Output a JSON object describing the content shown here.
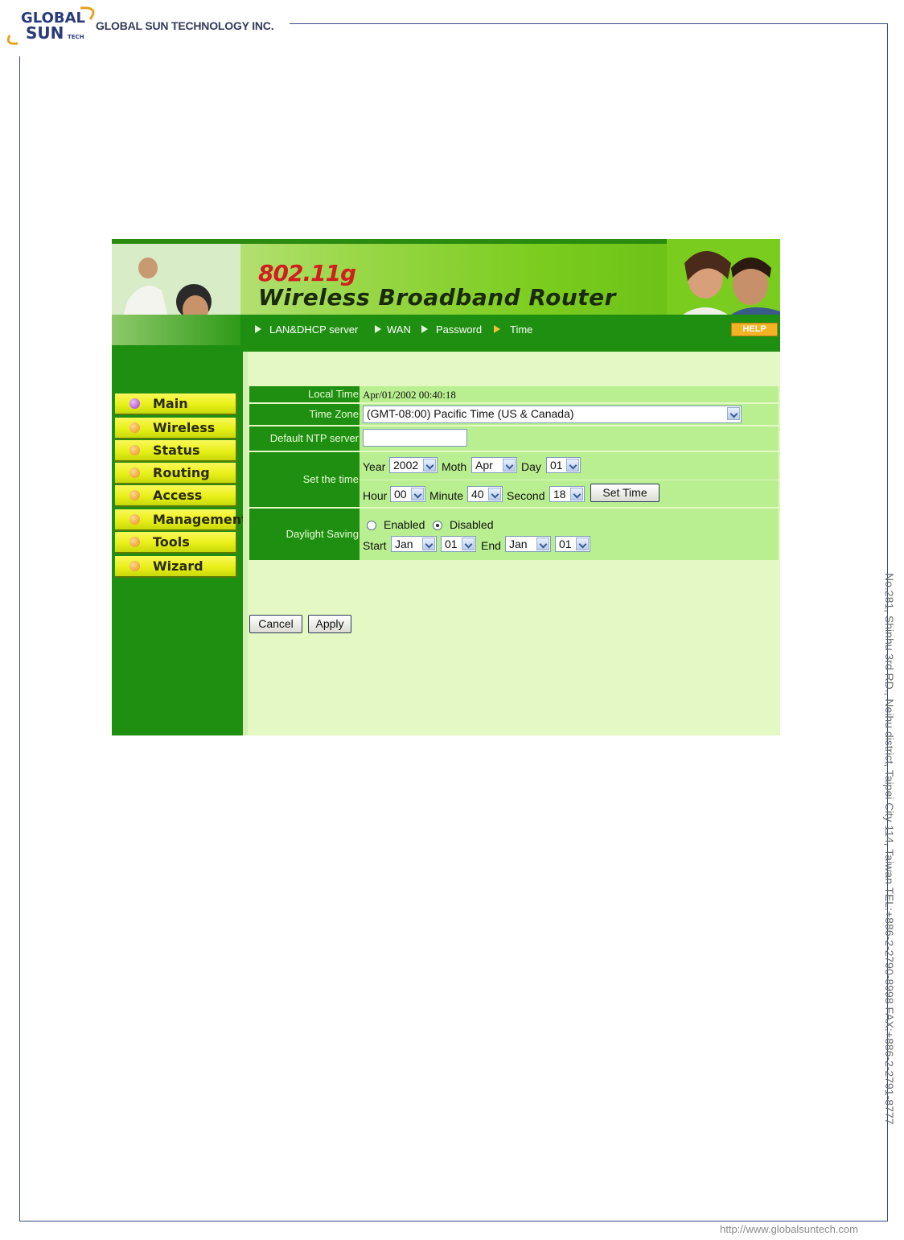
{
  "document": {
    "company_name": "GLOBAL SUN TECHNOLOGY INC.",
    "logo_text": "GLOBAL SUN TECH",
    "side_address": "No.281, Shinhu 3rd RD., Neihu district, Taipei City 114, Taiwan   TEL:+886-2-2790-8998   FAX:+886-2-2791-8777",
    "footer_url": "http://www.globalsuntech.com"
  },
  "header": {
    "model": "802.11g",
    "title": "Wireless Broadband Router",
    "nav": [
      {
        "label": "LAN&DHCP server"
      },
      {
        "label": "WAN"
      },
      {
        "label": "Password"
      },
      {
        "label": "Time",
        "active": true
      }
    ],
    "help_label": "HELP"
  },
  "sidebar": {
    "items": [
      {
        "label": "Main",
        "active": true
      },
      {
        "label": "Wireless"
      },
      {
        "label": "Status"
      },
      {
        "label": "Routing"
      },
      {
        "label": "Access"
      },
      {
        "label": "Management"
      },
      {
        "label": "Tools"
      },
      {
        "label": "Wizard"
      }
    ]
  },
  "form": {
    "local_time": {
      "label": "Local Time",
      "value": "Apr/01/2002 00:40:18"
    },
    "time_zone": {
      "label": "Time Zone",
      "value": "(GMT-08:00) Pacific Time (US & Canada)"
    },
    "ntp": {
      "label": "Default NTP server",
      "value": ""
    },
    "set_time": {
      "label": "Set the time",
      "year_label": "Year",
      "year": "2002",
      "month_label": "Moth",
      "month": "Apr",
      "day_label": "Day",
      "day": "01",
      "hour_label": "Hour",
      "hour": "00",
      "minute_label": "Minute",
      "minute": "40",
      "second_label": "Second",
      "second": "18",
      "button": "Set Time"
    },
    "daylight": {
      "label": "Daylight Saving",
      "enabled_label": "Enabled",
      "disabled_label": "Disabled",
      "selected": "Disabled",
      "start_label": "Start",
      "start_month": "Jan",
      "start_day": "01",
      "end_label": "End",
      "end_month": "Jan",
      "end_day": "01"
    },
    "cancel_label": "Cancel",
    "apply_label": "Apply"
  },
  "colors": {
    "dark_green": "#1f8f12",
    "light_green": "#b9ef90",
    "menu_yellow": "#e8f018",
    "model_red": "#d21e1e"
  }
}
